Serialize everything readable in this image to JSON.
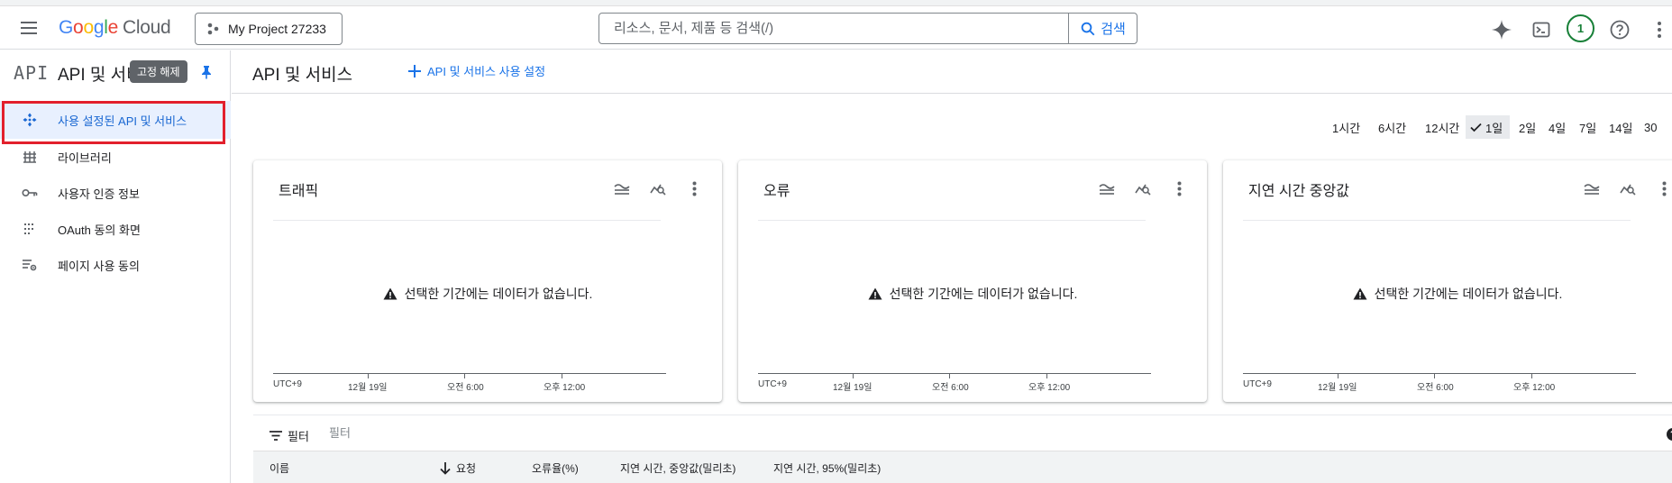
{
  "topbar": {
    "brand": {
      "letters": [
        "G",
        "o",
        "o",
        "g",
        "l",
        "e"
      ],
      "product": "Cloud"
    },
    "project": "My Project 27233",
    "search_placeholder": "리소스, 문서, 제품 등 검색(/)",
    "search_button": "검색",
    "avatar_initial": "1",
    "colors": {
      "accent": "#1a73e8",
      "avatar": "#188038"
    }
  },
  "sidebar": {
    "logo": "API",
    "title": "API 및 서비스",
    "tooltip": "고정 해제",
    "items": [
      {
        "label": "사용 설정된 API 및 서비스",
        "icon": "api-hub-icon",
        "active": true
      },
      {
        "label": "라이브러리",
        "icon": "library-icon"
      },
      {
        "label": "사용자 인증 정보",
        "icon": "key-icon"
      },
      {
        "label": "OAuth 동의 화면",
        "icon": "oauth-icon"
      },
      {
        "label": "페이지 사용 동의",
        "icon": "page-consent-icon"
      }
    ]
  },
  "main": {
    "title": "API 및 서비스",
    "enable_button": "API 및 서비스 사용 설정",
    "time_ranges": [
      "1시간",
      "6시간",
      "12시간",
      "1일",
      "2일",
      "4일",
      "7일",
      "14일",
      "30"
    ],
    "selected_range": "1일",
    "cards": [
      {
        "title": "트래픽",
        "message": "선택한 기간에는 데이터가 없습니다."
      },
      {
        "title": "오류",
        "message": "선택한 기간에는 데이터가 없습니다."
      },
      {
        "title": "지연 시간 중앙값",
        "message": "선택한 기간에는 데이터가 없습니다."
      }
    ],
    "axis": {
      "timezone": "UTC+9",
      "ticks": [
        "12월 19일",
        "오전 6:00",
        "오후 12:00"
      ]
    },
    "filter": {
      "label": "필터",
      "placeholder": "필터"
    },
    "table_headers": [
      "이름",
      "요청",
      "오류율(%)",
      "지연 시간, 중앙값(밀리초)",
      "지연 시간, 95%(밀리초)"
    ]
  }
}
